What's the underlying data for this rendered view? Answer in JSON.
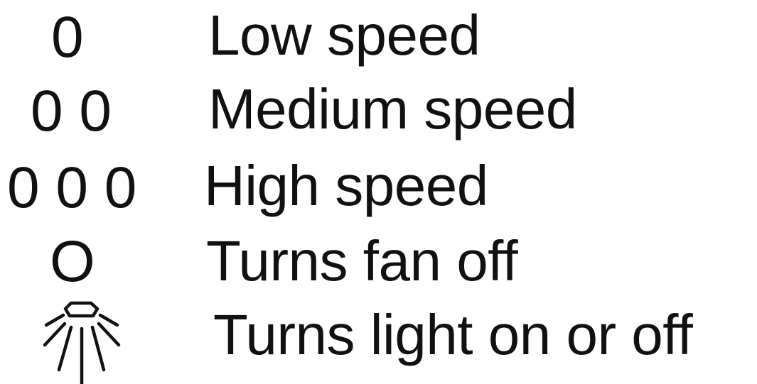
{
  "legend": {
    "items": [
      {
        "symbol": "0",
        "label": "Low speed"
      },
      {
        "symbol": "0 0",
        "label": "Medium speed"
      },
      {
        "symbol": "0 0 0",
        "label": "High speed"
      },
      {
        "symbol": "O",
        "label": "Turns fan off"
      },
      {
        "symbol_icon": "light-icon",
        "label": "Turns light on or off"
      }
    ]
  },
  "colors": {
    "text": "#111111",
    "background": "#ffffff"
  }
}
